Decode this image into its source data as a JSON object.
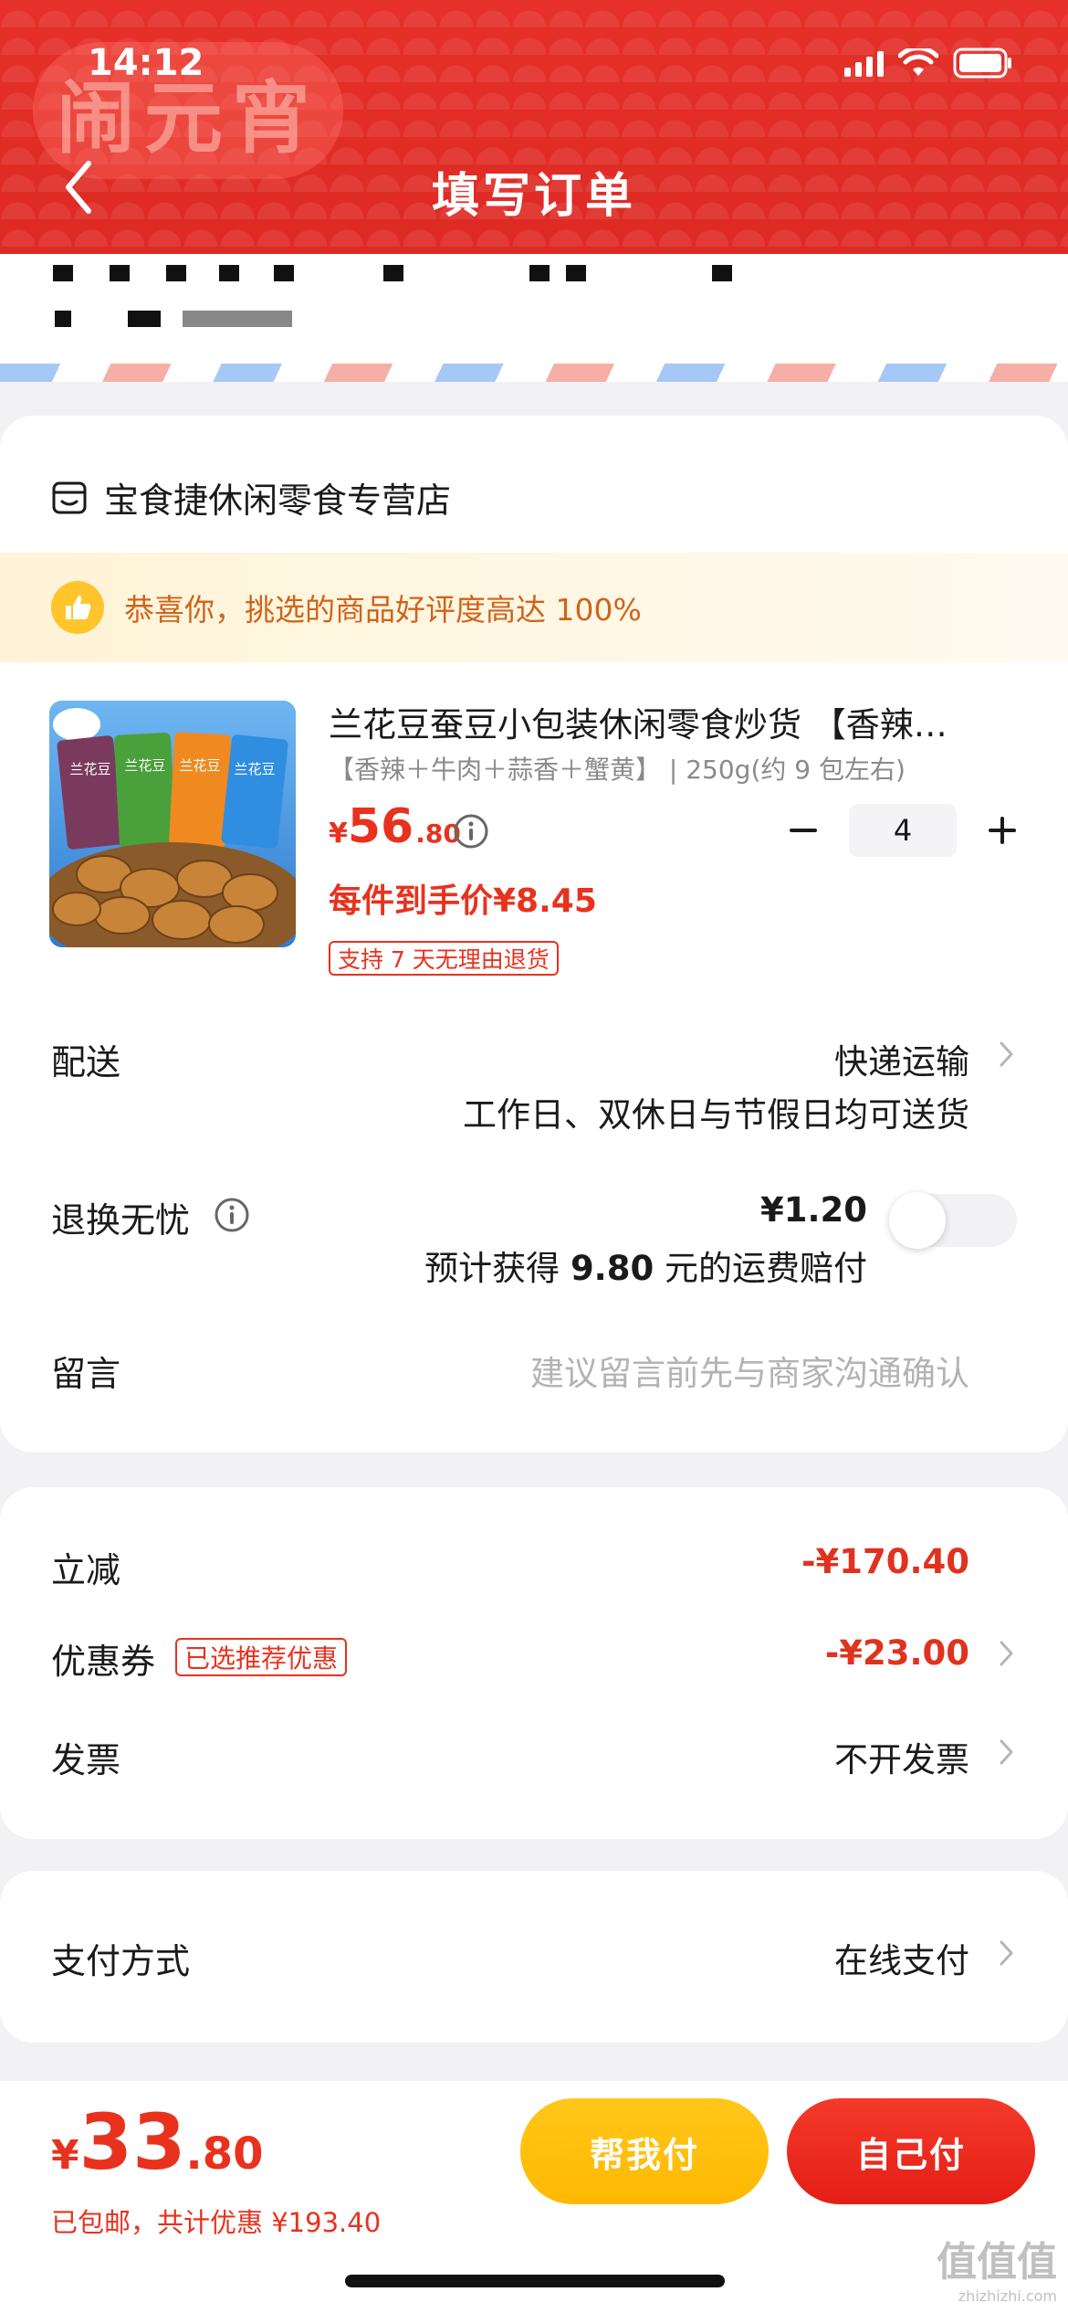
{
  "status_bar": {
    "time": "14:12"
  },
  "header": {
    "festival_mark": "闹元宵",
    "title": "填写订单",
    "colors": {
      "background": "#e2302a"
    }
  },
  "store": {
    "name": "宝食捷休闲零食专营店",
    "icon": "store-icon"
  },
  "praise_banner": {
    "text": "恭喜你，挑选的商品好评度高达 100%",
    "icon": "thumbs-up-icon"
  },
  "product": {
    "title": "兰花豆蚕豆小包装休闲零食炒货 【香辣…",
    "spec": "【香辣＋牛肉＋蒜香＋蟹黄】 | 250g(约 9 包左右)",
    "price_currency": "¥",
    "price_int": "56",
    "price_dec": ".80",
    "quantity": "4",
    "unit_price": "每件到手价¥8.45",
    "return_badge": "支持 7 天无理由退货",
    "bag_labels": [
      "兰花豆",
      "兰花豆",
      "兰花豆",
      "兰花豆"
    ]
  },
  "delivery": {
    "label": "配送",
    "method": "快递运输",
    "note": "工作日、双休日与节假日均可送货"
  },
  "return_worry": {
    "label": "退换无忧",
    "price": "¥1.20",
    "note_prefix": "预计获得 ",
    "note_amount": "9.80",
    "note_suffix": " 元的运费赔付",
    "enabled": false
  },
  "message": {
    "label": "留言",
    "placeholder": "建议留言前先与商家沟通确认"
  },
  "discount": {
    "instant_label": "立减",
    "instant_value": "-¥170.40",
    "coupon_label": "优惠券",
    "coupon_tag": "已选推荐优惠",
    "coupon_value": "-¥23.00",
    "invoice_label": "发票",
    "invoice_value": "不开发票"
  },
  "payment": {
    "label": "支付方式",
    "value": "在线支付"
  },
  "bottom_bar": {
    "currency": "¥",
    "total_int": "33",
    "total_dec": ".80",
    "note": "已包邮，共计优惠 ¥193.40",
    "help_pay": "帮我付",
    "self_pay": "自己付"
  },
  "watermark": {
    "text": "值值值",
    "url": "zhizhizhi.com"
  }
}
